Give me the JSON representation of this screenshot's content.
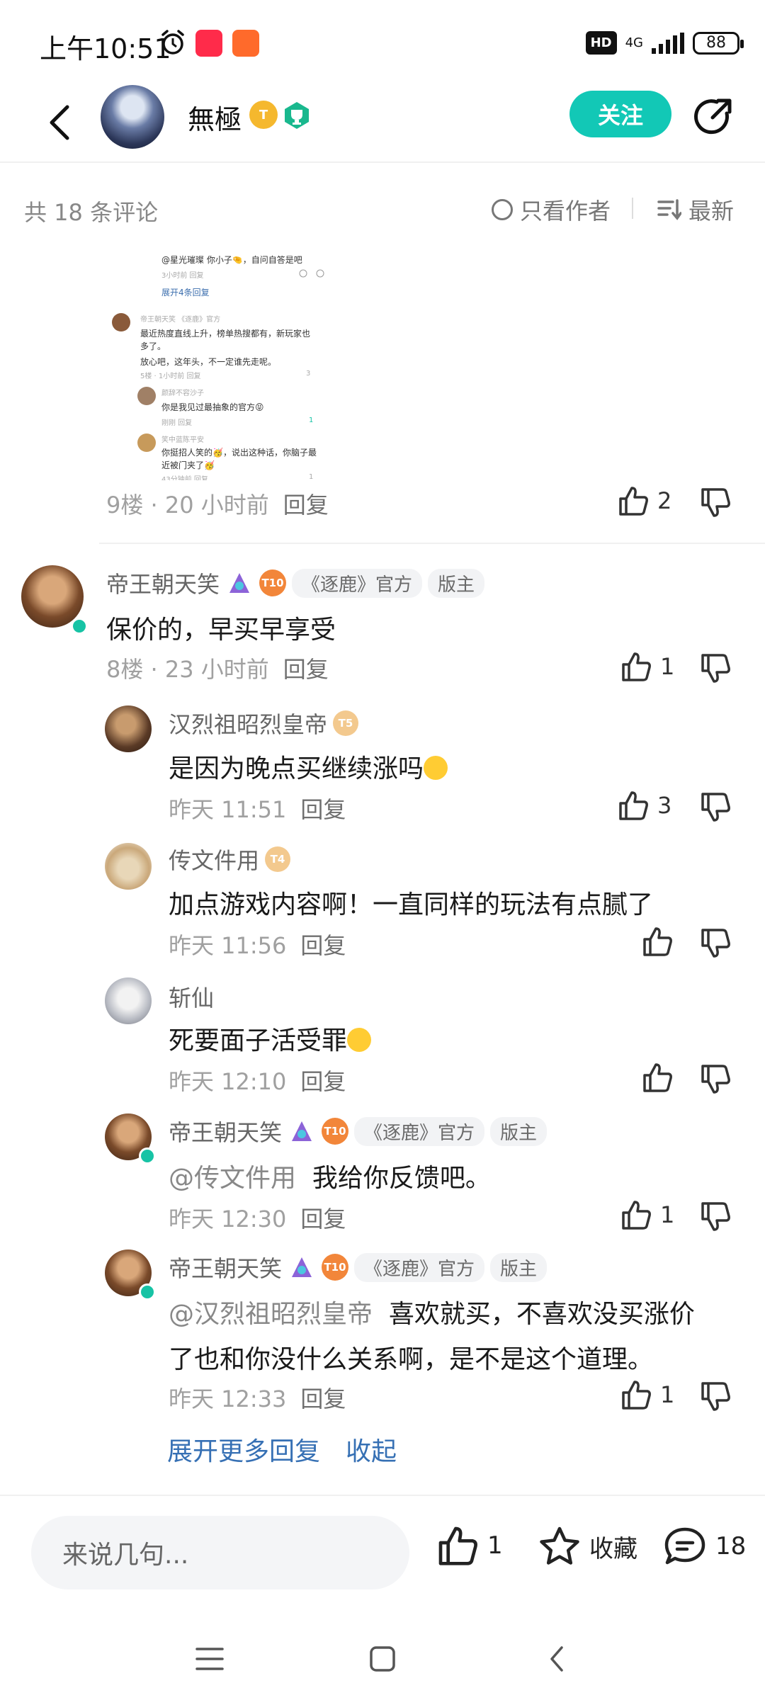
{
  "status_bar": {
    "time": "上午10:51",
    "hd": "HD",
    "network": "4G",
    "battery": "88"
  },
  "header": {
    "author_name": "無極",
    "author_level": "T",
    "follow_label": "关注"
  },
  "sort_bar": {
    "count_text": "共 18 条评论",
    "author_only": "只看作者",
    "sort_label": "最新"
  },
  "screenshot": {
    "lines": [
      "@星光璀璨  你小子🤏，自问自答是吧",
      "3小时前  回复",
      "展开4条回复",
      "帝王朝天笑  《逐鹿》官方",
      "最近热度直线上升，榜单热搜都有，新玩家也",
      "多了。",
      "放心吧，这年头，不一定谁先走呢。",
      "5楼 · 1小时前  回复",
      "3",
      "颜辞不容沙子",
      "你是我见过最抽象的官方😝",
      "刚刚  回复",
      "1",
      "笑中蓝陈平安",
      "你挺招人笑的🥳，说出这种话，你脑子最",
      "近被门夹了🥳",
      "43分钟前  回复",
      "1"
    ]
  },
  "first_comment": {
    "meta": "9楼 · 20 小时前",
    "reply": "回复",
    "likes": "2"
  },
  "main_comment": {
    "user": "帝王朝天笑",
    "level": "T10",
    "official_tag": "《逐鹿》官方",
    "mod_tag": "版主",
    "content": "保价的，早买早享受",
    "meta": "8楼 · 23 小时前",
    "reply": "回复",
    "likes": "1"
  },
  "replies": [
    {
      "user": "汉烈祖昭烈皇帝",
      "level": "T5",
      "content": "是因为晚点买继续涨吗",
      "time": "昨天 11:51",
      "reply": "回复",
      "likes": "3"
    },
    {
      "user": "传文件用",
      "level": "T4",
      "content": "加点游戏内容啊！一直同样的玩法有点腻了",
      "time": "昨天 11:56",
      "reply": "回复",
      "likes": ""
    },
    {
      "user": "斩仙",
      "level": "",
      "content": "死要面子活受罪",
      "time": "昨天 12:10",
      "reply": "回复",
      "likes": ""
    },
    {
      "user": "帝王朝天笑",
      "level": "T10",
      "official_tag": "《逐鹿》官方",
      "mod_tag": "版主",
      "mention": "@传文件用",
      "content": "我给你反馈吧。",
      "time": "昨天 12:30",
      "reply": "回复",
      "likes": "1"
    },
    {
      "user": "帝王朝天笑",
      "level": "T10",
      "official_tag": "《逐鹿》官方",
      "mod_tag": "版主",
      "mention": "@汉烈祖昭烈皇帝",
      "content": "喜欢就买，不喜欢没买涨价",
      "content2": "了也和你没什么关系啊，是不是这个道理。",
      "time": "昨天 12:33",
      "reply": "回复",
      "likes": "1"
    }
  ],
  "expand": {
    "more": "展开更多回复",
    "collapse": "收起"
  },
  "bottom_bar": {
    "placeholder": "来说几句...",
    "likes": "1",
    "favorite": "收藏",
    "comments": "18"
  },
  "colors": {
    "accent": "#12c8b6",
    "link": "#3670b4",
    "verified": "#17c3a5"
  }
}
